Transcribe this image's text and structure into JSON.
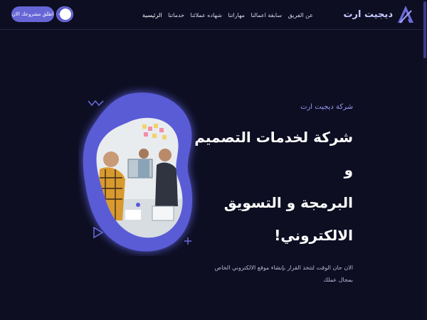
{
  "brand": {
    "name": "ديجيت ارت",
    "logo_icon": "triangle-a-logo-icon",
    "accent": "#5a5bd6"
  },
  "nav": {
    "links": [
      {
        "label": "الرئيسية",
        "active": true
      },
      {
        "label": "خدماتنا"
      },
      {
        "label": "شهاده عملائنا"
      },
      {
        "label": "مهاراتنا"
      },
      {
        "label": "سابقة اعمالنا"
      },
      {
        "label": "عن الفريق"
      }
    ],
    "cta_label": "اطلق مشروعك الان",
    "theme_toggle_icon": "sun-icon"
  },
  "hero": {
    "eyebrow": "شركة ديجيت ارت",
    "headline_lines": [
      "شركة لخدمات التصميم و",
      "البرمجة و التسويق الالكتروني!"
    ],
    "description": "الان حان الوقت لتتخذ القرار بإنشاء موقع الالكتروني الخاص بمجال عملك"
  },
  "colors": {
    "background": "#0d0e22",
    "accent": "#6766d6",
    "blob": "#5a5bd6"
  }
}
